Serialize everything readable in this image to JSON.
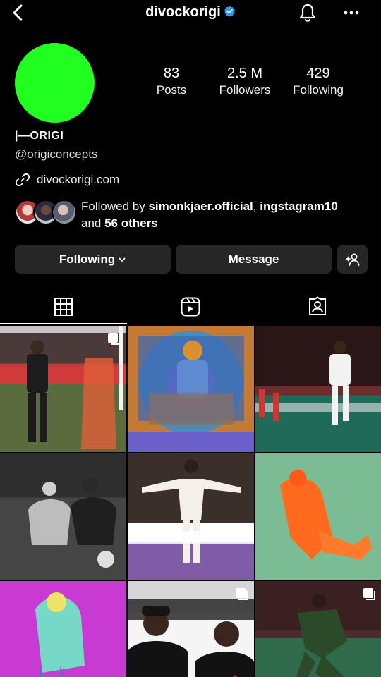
{
  "header": {
    "username": "divockorigi",
    "verified_color": "#3897f0"
  },
  "profile": {
    "avatar_color": "#20ff20",
    "name": "|—ORIGI",
    "handle": "@origiconcepts",
    "link": "divockorigi.com"
  },
  "stats": [
    {
      "value": "83",
      "label": "Posts"
    },
    {
      "value": "2.5 M",
      "label": "Followers"
    },
    {
      "value": "429",
      "label": "Following"
    }
  ],
  "followed_by": {
    "prefix": "Followed by ",
    "user1": "simonkjaer.official",
    "sep": ", ",
    "user2": "ingstagram10",
    "and": "and ",
    "others": "56 others"
  },
  "buttons": {
    "following": "Following",
    "message": "Message"
  },
  "tabs": [
    {
      "icon": "grid-icon",
      "active": true
    },
    {
      "icon": "reels-icon",
      "active": false
    },
    {
      "icon": "tagged-icon",
      "active": false
    }
  ],
  "posts": [
    {
      "subject": "player training field",
      "multi": true
    },
    {
      "subject": "colorized seated portrait",
      "multi": false
    },
    {
      "subject": "player in stadium",
      "multi": false
    },
    {
      "subject": "two players sitting",
      "multi": false
    },
    {
      "subject": "player arms wide",
      "multi": false
    },
    {
      "subject": "orange figure on green",
      "multi": false
    },
    {
      "subject": "colorized figure on magenta",
      "multi": false
    },
    {
      "subject": "two people in car",
      "multi": true
    },
    {
      "subject": "player kicking ball",
      "multi": true
    }
  ]
}
